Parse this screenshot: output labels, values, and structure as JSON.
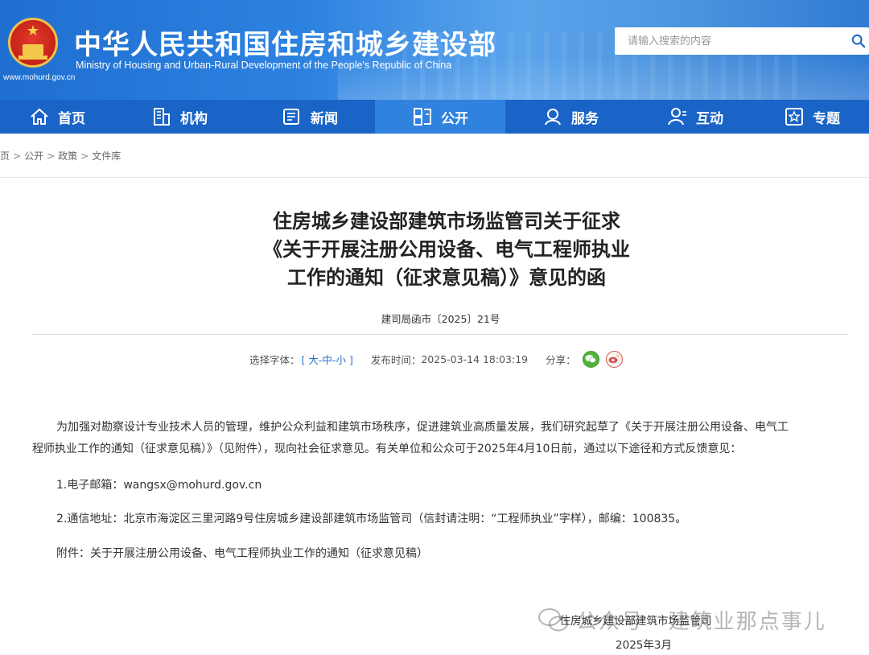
{
  "header": {
    "site_title": "中华人民共和国住房和城乡建设部",
    "site_subtitle": "Ministry of Housing and Urban-Rural Development of the People's Republic of China",
    "site_url": "www.mohurd.gov.cn",
    "search_placeholder": "请输入搜索的内容",
    "brand_color": "#1a64c8"
  },
  "nav": {
    "items": [
      {
        "label": "首页",
        "icon": "home-icon"
      },
      {
        "label": "机构",
        "icon": "building-icon"
      },
      {
        "label": "新闻",
        "icon": "news-icon"
      },
      {
        "label": "公开",
        "icon": "document-icon",
        "active": true
      },
      {
        "label": "服务",
        "icon": "service-icon"
      },
      {
        "label": "互动",
        "icon": "user-icon"
      },
      {
        "label": "专题",
        "icon": "star-icon"
      }
    ]
  },
  "breadcrumb": [
    "页",
    "公开",
    "政策",
    "文件库"
  ],
  "article": {
    "title_line1": "住房城乡建设部建筑市场监管司关于征求",
    "title_line2": "《关于开展注册公用设备、电气工程师执业",
    "title_line3": "工作的通知（征求意见稿）》意见的函",
    "doc_number": "建司局函市〔2025〕21号",
    "font_label": "选择字体：",
    "font_open": "[",
    "font_large": "大",
    "font_medium": "中",
    "font_small": "小",
    "font_close": "]",
    "font_sep": "-",
    "publish_label": "发布时间：",
    "publish_time": "2025-03-14 18:03:19",
    "share_label": "分享：",
    "para1_line1": "为加强对勘察设计专业技术人员的管理，维护公众利益和建筑市场秩序，促进建筑业高质量发展，我们研究起草了《关于开展注册公用设备、电气工",
    "para1_line2": "程师执业工作的通知（征求意见稿）》（见附件），现向社会征求意见。有关单位和公众可于2025年4月10日前，通过以下途径和方式反馈意见：",
    "item1": "1.电子邮箱：wangsx@mohurd.gov.cn",
    "item2": "2.通信地址：北京市海淀区三里河路9号住房城乡建设部建筑市场监管司（信封请注明：“工程师执业”字样），邮编：100835。",
    "attachment": "附件：关于开展注册公用设备、电气工程师执业工作的通知（征求意见稿）",
    "signature": "住房城乡建设部建筑市场监管司",
    "sign_date": "2025年3月"
  },
  "watermark": {
    "text": "公众号 · 建筑业那点事儿"
  }
}
